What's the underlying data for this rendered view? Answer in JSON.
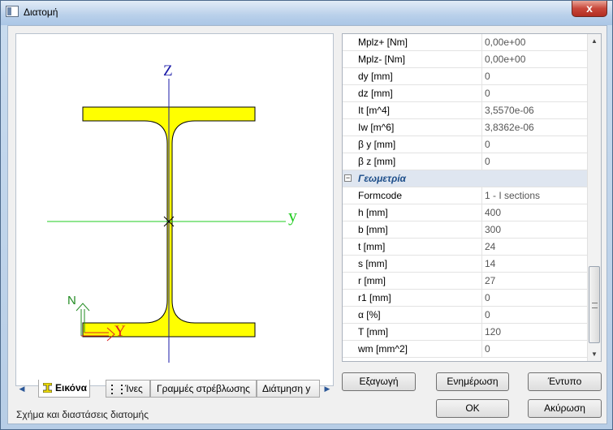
{
  "window": {
    "title": "Διατομή",
    "close_label": "x"
  },
  "drawing": {
    "axis_z_label": "Z",
    "axis_y_label": "y",
    "local_axis_n_label": "N",
    "local_axis_y_label": "Y",
    "section_color": "#ffff00",
    "axis_z_color": "#1a1aa8",
    "axis_y_color": "#22cc22"
  },
  "tabs": {
    "items": [
      {
        "label": "Εικόνα",
        "icon": "i-beam-icon"
      },
      {
        "label": "Ίνες",
        "icon": "fibers-icon"
      },
      {
        "label": "Γραμμές στρέβλωσης"
      },
      {
        "label": "Διάτμηση y"
      }
    ]
  },
  "hint": "Σχήμα και διαστάσεις διατομής",
  "properties": {
    "rows_top": [
      {
        "name": "Mplz+ [Nm]",
        "value": "0,00e+00"
      },
      {
        "name": "Mplz- [Nm]",
        "value": "0,00e+00"
      },
      {
        "name": "dy [mm]",
        "value": "0"
      },
      {
        "name": "dz [mm]",
        "value": "0"
      },
      {
        "name": "It [m^4]",
        "value": "3,5570e-06"
      },
      {
        "name": "Iw [m^6]",
        "value": "3,8362e-06"
      },
      {
        "name": "β y [mm]",
        "value": "0"
      },
      {
        "name": "β z [mm]",
        "value": "0"
      }
    ],
    "category": {
      "name": "Γεωμετρία",
      "expander": "−"
    },
    "rows_geom": [
      {
        "name": "Formcode",
        "value": "1 - I sections"
      },
      {
        "name": "h [mm]",
        "value": "400"
      },
      {
        "name": "b [mm]",
        "value": "300"
      },
      {
        "name": "t [mm]",
        "value": "24"
      },
      {
        "name": "s [mm]",
        "value": "14"
      },
      {
        "name": "r [mm]",
        "value": "27"
      },
      {
        "name": "r1 [mm]",
        "value": "0"
      },
      {
        "name": "α [%]",
        "value": "0"
      },
      {
        "name": "T [mm]",
        "value": "120"
      },
      {
        "name": "wm [mm^2]",
        "value": "0"
      }
    ]
  },
  "buttons": {
    "export": "Εξαγωγή",
    "update": "Ενημέρωση",
    "print": "Έντυπο",
    "ok": "OK",
    "cancel": "Ακύρωση"
  }
}
